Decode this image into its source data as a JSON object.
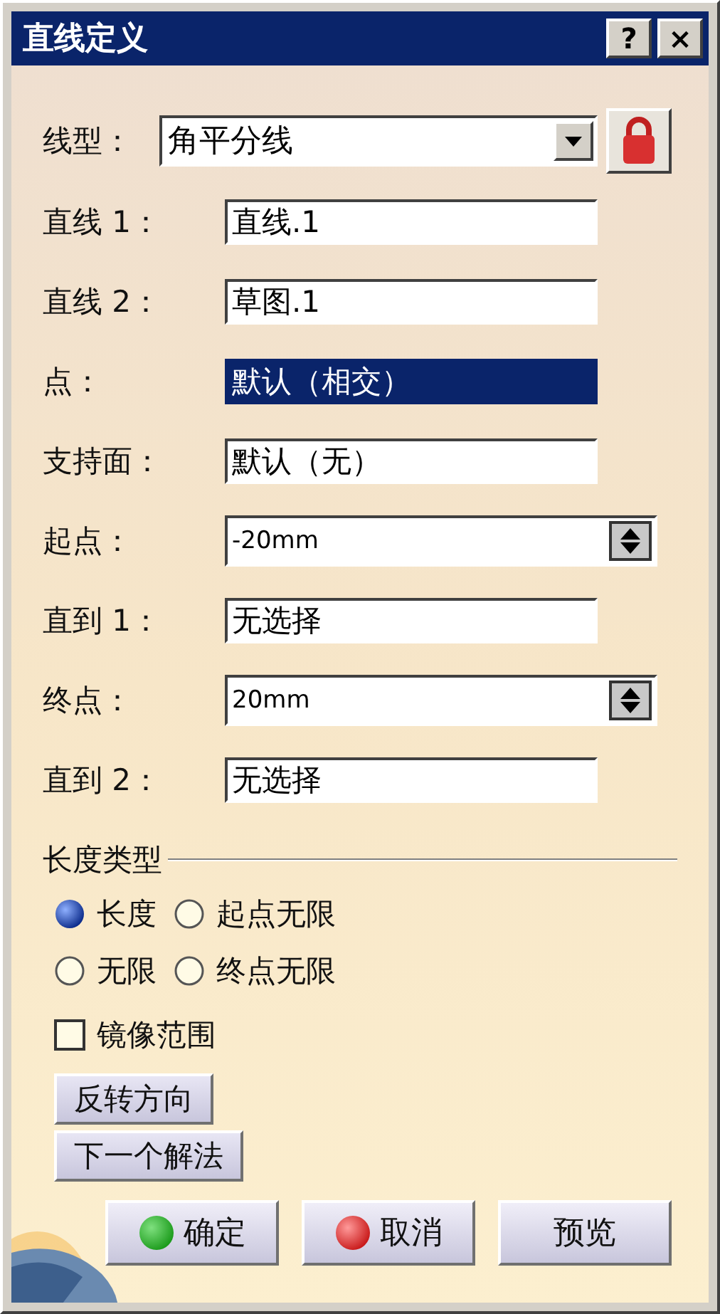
{
  "window": {
    "title": "直线定义",
    "help_button": "?",
    "close_button": "×"
  },
  "line_type": {
    "label": "线型：",
    "value": "角平分线"
  },
  "fields": [
    {
      "label": "直线 1：",
      "value": "直线.1",
      "kind": "text",
      "selected": false
    },
    {
      "label": "直线 2：",
      "value": "草图.1",
      "kind": "text",
      "selected": false
    },
    {
      "label": "点：",
      "value": "默认（相交）",
      "kind": "text",
      "selected": true
    },
    {
      "label": "支持面：",
      "value": "默认（无）",
      "kind": "text",
      "selected": false
    },
    {
      "label": "起点：",
      "value": "-20mm",
      "kind": "spin",
      "selected": false
    },
    {
      "label": "直到 1：",
      "value": "无选择",
      "kind": "text",
      "selected": false
    },
    {
      "label": "终点：",
      "value": "20mm",
      "kind": "spin",
      "selected": false
    },
    {
      "label": "直到 2：",
      "value": "无选择",
      "kind": "text",
      "selected": false
    }
  ],
  "length_type": {
    "title": "长度类型",
    "options": [
      {
        "label": "长度",
        "selected": true
      },
      {
        "label": "起点无限",
        "selected": false
      },
      {
        "label": "无限",
        "selected": false
      },
      {
        "label": "终点无限",
        "selected": false
      }
    ]
  },
  "mirror": {
    "label": "镜像范围",
    "checked": false
  },
  "actions": [
    "反转方向",
    "下一个解法"
  ],
  "buttons": [
    {
      "label": "确定",
      "kind": "ok"
    },
    {
      "label": "取消",
      "kind": "cancel"
    },
    {
      "label": "预览",
      "kind": "plain"
    }
  ]
}
